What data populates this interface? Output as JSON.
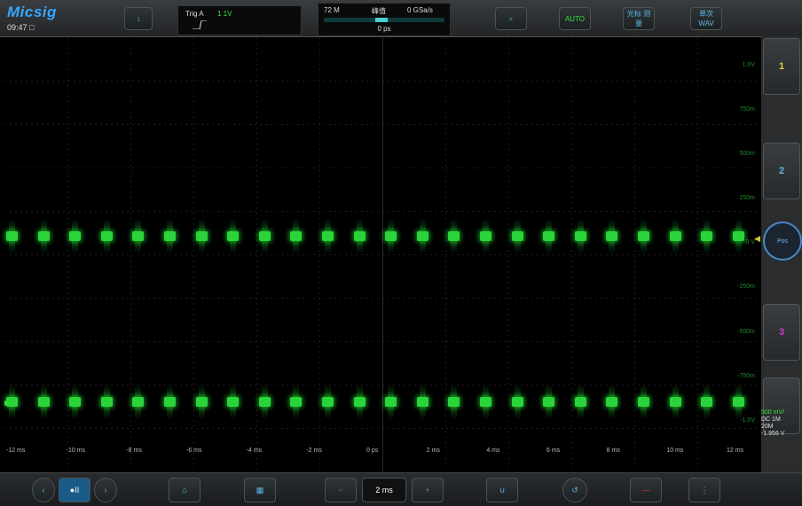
{
  "header": {
    "logo": "Micsig",
    "clock": "09:47",
    "trigger": {
      "label": "Trig A",
      "source": "1 1V"
    },
    "timebase": {
      "depth": "72 M",
      "mode": "峰值",
      "rate": "0 GSa/s",
      "delay": "0 ps",
      "memory_position": 0.48
    }
  },
  "toolbar": {
    "menu_label": "↕",
    "auto_label": "AUTO",
    "zoom_label": "⌕",
    "cursor_label": "光标 测量",
    "wave_label": "单次 WAV"
  },
  "channels": {
    "ch1_label": "1",
    "ch2_label": "2",
    "ch3_label": "3",
    "ch4_label": "",
    "knob_label": "Pos",
    "ch_info_scale": "500 mV/",
    "ch_info_coupling": "DC  1M",
    "ch_info_bw": "20M",
    "ch_info_offset": "-1.956 V"
  },
  "x_axis_labels": [
    "-12 ms",
    "-10 ms",
    "-8 ms",
    "-6 ms",
    "-4 ms",
    "-2 ms",
    "0 ps",
    "2 ms",
    "4 ms",
    "6 ms",
    "8 ms",
    "10 ms",
    "12 ms"
  ],
  "y_axis_labels": [
    "1.0V",
    "750m",
    "500m",
    "250m",
    "0 V",
    "-250m",
    "-500m",
    "-750m",
    "-1.0V"
  ],
  "bottom": {
    "record_label": "●II",
    "timebase_value": "2 ms"
  },
  "colors": {
    "accent": "#35a9ff",
    "ch1": "#2bd43a",
    "ch3": "#d43ad4",
    "trigger": "#d7c63a",
    "ch2": "#e8c93a"
  }
}
